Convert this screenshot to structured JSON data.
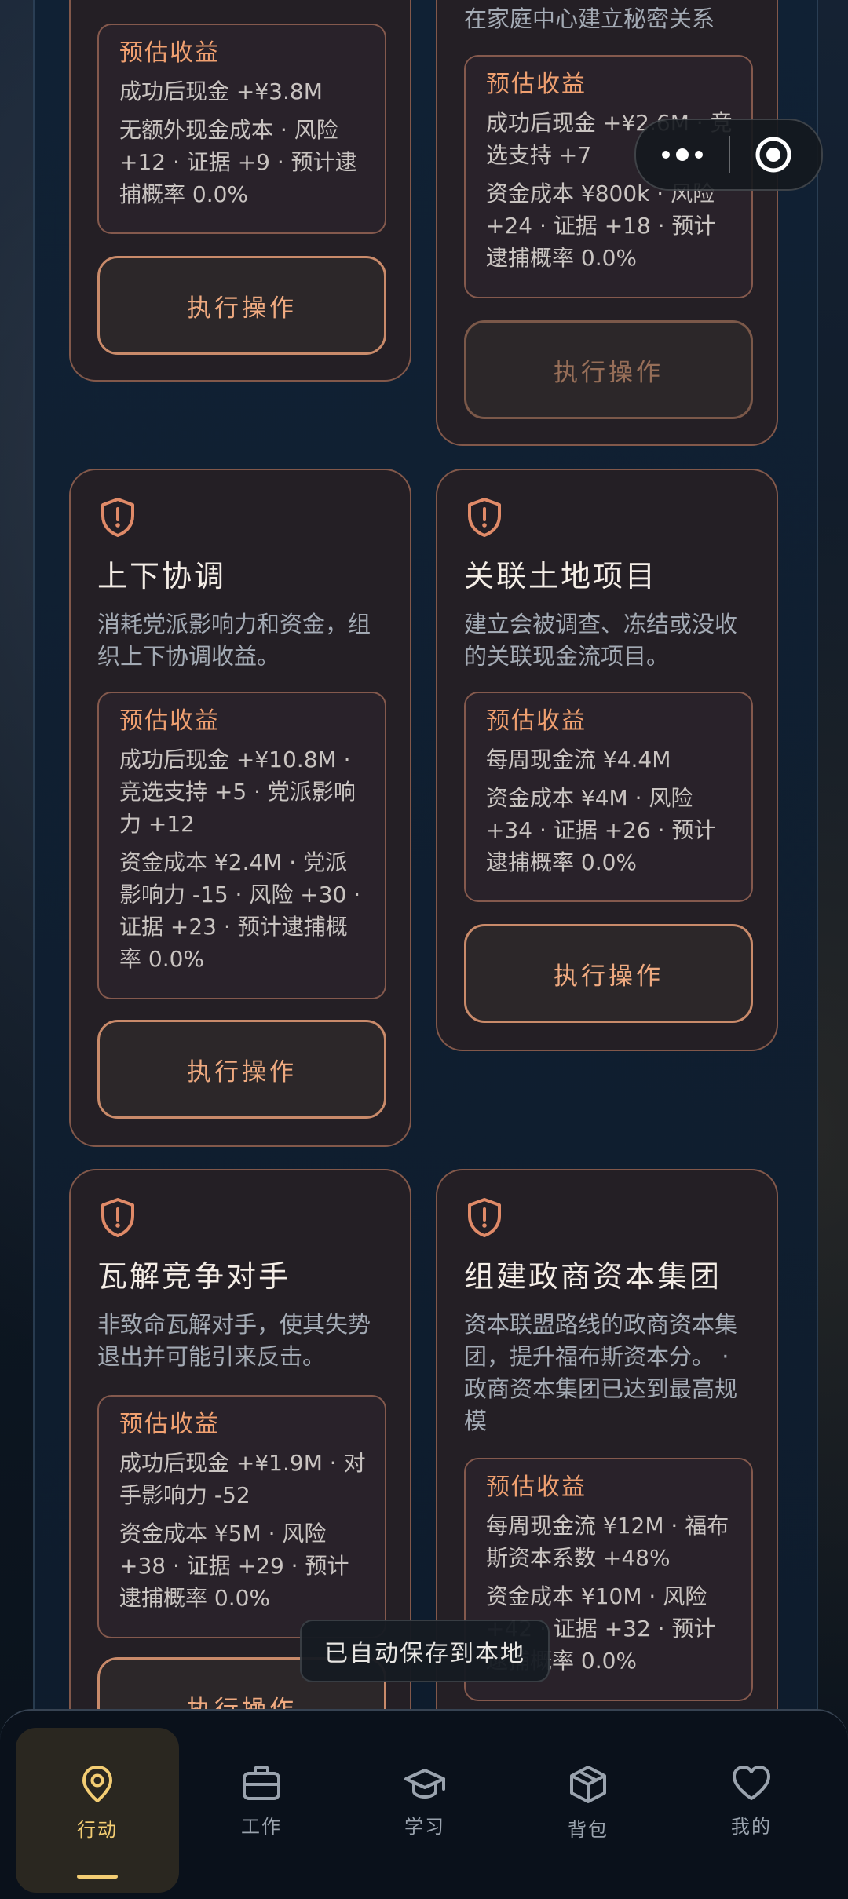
{
  "cards": {
    "c1": {
      "box": {
        "label": "预估收益",
        "l1": "成功后现金 +¥3.8M",
        "l2": "无额外现金成本 · 风险 +12 · 证据 +9 · 预计逮捕概率 0.0%"
      },
      "button": "执行操作"
    },
    "c2": {
      "desc": "在家庭中心建立秘密关系",
      "box": {
        "label": "预估收益",
        "l1": "成功后现金 +¥2.6M · 竞选支持 +7",
        "l2": "资金成本 ¥800k · 风险 +24 · 证据 +18 · 预计逮捕概率 0.0%"
      },
      "button": "执行操作"
    },
    "c3": {
      "title": "上下协调",
      "desc": "消耗党派影响力和资金，组织上下协调收益。",
      "box": {
        "label": "预估收益",
        "l1": "成功后现金 +¥10.8M · 竞选支持 +5 · 党派影响力 +12",
        "l2": "资金成本 ¥2.4M · 党派影响力 -15 · 风险 +30 · 证据 +23 · 预计逮捕概率 0.0%"
      },
      "button": "执行操作"
    },
    "c4": {
      "title": "关联土地项目",
      "desc": "建立会被调查、冻结或没收的关联现金流项目。",
      "box": {
        "label": "预估收益",
        "l1": "每周现金流 ¥4.4M",
        "l2": "资金成本 ¥4M · 风险 +34 · 证据 +26 · 预计逮捕概率 0.0%"
      },
      "button": "执行操作"
    },
    "c5": {
      "title": "瓦解竞争对手",
      "desc": "非致命瓦解对手，使其失势退出并可能引来反击。",
      "box": {
        "label": "预估收益",
        "l1": "成功后现金 +¥1.9M · 对手影响力 -52",
        "l2": "资金成本 ¥5M · 风险 +38 · 证据 +29 · 预计逮捕概率 0.0%"
      },
      "button": "执行操作"
    },
    "c6": {
      "title": "组建政商资本集团",
      "desc": "资本联盟路线的政商资本集团，提升福布斯资本分。 · 政商资本集团已达到最高规模",
      "box": {
        "label": "预估收益",
        "l1": "每周现金流 ¥12M · 福布斯资本系数 +48%",
        "l2": "资金成本 ¥10M · 风险 +42 · 证据 +32 · 预计逮捕概率 0.0%"
      }
    }
  },
  "toast": "已自动保存到本地",
  "tabs": [
    {
      "label": "行动",
      "icon": "location-pin-icon",
      "active": true
    },
    {
      "label": "工作",
      "icon": "briefcase-icon"
    },
    {
      "label": "学习",
      "icon": "graduation-cap-icon"
    },
    {
      "label": "背包",
      "icon": "package-box-icon"
    },
    {
      "label": "我的",
      "icon": "heart-icon"
    }
  ],
  "colors": {
    "accent": "#f0a070",
    "active_tab": "#f3cd73",
    "card_bg": "#241f25",
    "panel_bg": "#10213a"
  }
}
